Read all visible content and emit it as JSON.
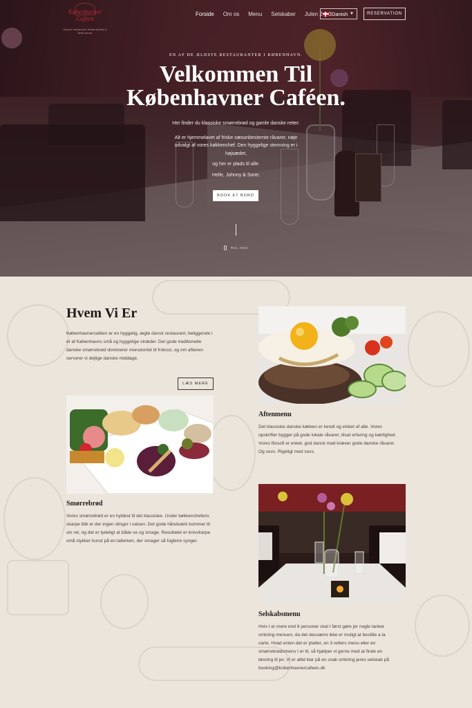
{
  "nav": {
    "logo_name": "Københavner Caféen",
    "logo_sub": "Dansk restaurant Smørrebrød & Aftenmenu",
    "items": [
      "Forside",
      "Om os",
      "Menu",
      "Selskaber",
      "Julen 2023"
    ],
    "language": "Danish",
    "reservation": "RESERVATION"
  },
  "hero": {
    "tagline": "EN AF DE ÆLDSTE RESTAURANTER I KØBENHAVN.",
    "title_line1": "Velkommen Til",
    "title_line2": "Københavner Caféen.",
    "p1": "Her finder du klassiske smørrebrød og gamle danske retter.",
    "p2": "Alt er hjemmelavet af friske sæsonbestemte råvarer, nøje udvalgt af vores køkkenchef. Den hyggelige stemning er i højsædet,",
    "p3": "og her er plads til alle.",
    "p4": "Helle, Johnny & Sune.",
    "book": "BOOK ET BORD",
    "scroll": "RUL NED"
  },
  "about": {
    "title": "Hvem Vi Er",
    "text": "Københavnercaféen er en hyggelig, ægte dansk restaurant, beliggende i et af Københavns små og hyggelige stræder. Det gode traditionelle danske smørrebrød dominerer menukortet til frokost, og om aftenen serverer vi dejlige danske middage.",
    "more": "LÆS MERE"
  },
  "aftenmenu": {
    "title": "Aftenmenu",
    "text": "Det klassiske danske køkken er kendt og elsket af alle. Vores opskrifter bygger på gode lokale råvarer, tilsat erfaring og kærlighed. Vores filosofi er enkel, god dansk mad kræver gode danske råvarer. Og sovs. Rigeligt med sovs."
  },
  "smorrebrod": {
    "title": "Smørrebrød",
    "text": "Vores smørrebrød er en hyldest til det klassiske. Under køkkenchefens skarpe blik er der ingen slinger i valsen. Det gode håndværk kommer til sin ret, og det er tydeligt at både se og smage. Resultatet er knivskarpe små stykker kunst på en tallerken, der smager så fuglene synger."
  },
  "selskab": {
    "title": "Selskabsmenu",
    "text": "Hvis I er mere end 8 personer skal I først gøre jer nogle tanker omkring menuen, da det desværre ikke er muligt at bestille a la carte. Hvad enten det er platter, en 3 retters menu eller en smørrebrødsmenu I er til, så hjælper vi gerne med at finde en løsning til jer. Vi er altid klar på en snak omkring jeres selskab på booking@kobenhavnercafeen.dk"
  }
}
